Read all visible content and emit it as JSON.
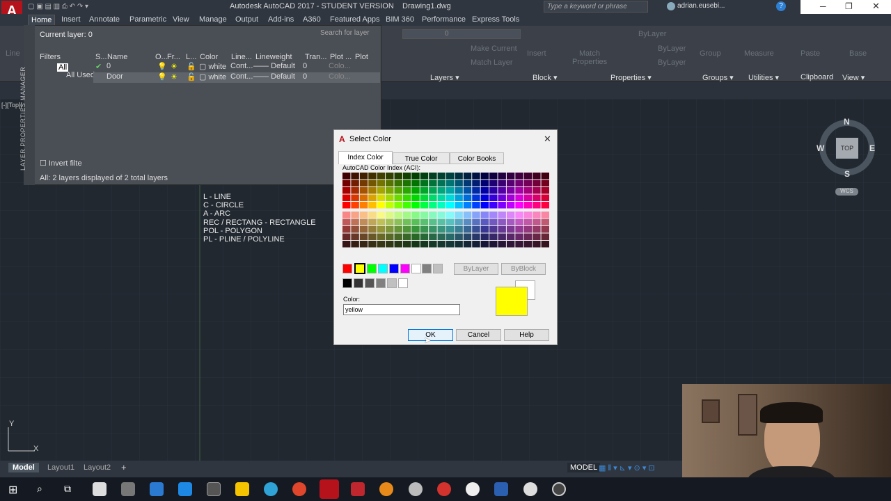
{
  "app": {
    "title": "Autodesk AutoCAD 2017 - STUDENT VERSION",
    "file": "Drawing1.dwg",
    "search_placeholder": "Type a keyword or phrase",
    "user": "adrian.eusebi...",
    "logo": "A"
  },
  "ribbon": {
    "tabs": [
      "Home",
      "Insert",
      "Annotate",
      "Parametric",
      "View",
      "Manage",
      "Output",
      "Add-ins",
      "A360",
      "Featured Apps",
      "BIM 360",
      "Performance",
      "Express Tools"
    ],
    "panels": {
      "layers": "Layers ▾",
      "block": "Block ▾",
      "properties": "Properties ▾",
      "groups": "Groups ▾",
      "utilities": "Utilities ▾",
      "clipboard": "Clipboard",
      "view": "View ▾"
    },
    "make_current": "Make Current",
    "match_layer": "Match Layer",
    "insert": "Insert",
    "match_properties": "Match Properties",
    "bylayer1": "ByLayer",
    "bylayer2": "ByLayer",
    "bylayer3": "ByLayer",
    "group": "Group",
    "measure": "Measure",
    "paste": "Paste",
    "base": "Base",
    "line": "Line",
    "layer_value": "0"
  },
  "viewport_label": "[-][Top][",
  "layer_manager": {
    "side_title": "LAYER PROPERTIES MANAGER",
    "current_layer": "Current layer: 0",
    "search": "Search for layer",
    "filters_label": "Filters",
    "all": "All",
    "all_used": "All Used ...",
    "invert_filter": "Invert filte",
    "status": "All: 2 layers displayed of 2 total layers",
    "headers": [
      "S...",
      "Name",
      "O...",
      "Fr...",
      "L...",
      "Color",
      "Line...",
      "Lineweight",
      "Tran...",
      "Plot ...",
      "Plot"
    ],
    "rows": [
      {
        "name": "0",
        "color": "white",
        "linetype": "Cont...",
        "lineweight": "Default",
        "transparency": "0",
        "plot_style": "Colo..."
      },
      {
        "name": "Door",
        "color": "white",
        "linetype": "Cont...",
        "lineweight": "Default",
        "transparency": "0",
        "plot_style": "Colo..."
      }
    ]
  },
  "canvas_notes": [
    "L - LINE",
    "C - CIRCLE",
    "A - ARC",
    "REC / RECTANG - RECTANGLE",
    "POL - POLYGON",
    "PL - PLINE / POLYLINE"
  ],
  "dialog": {
    "title": "Select Color",
    "tabs": [
      "Index Color",
      "True Color",
      "Color Books"
    ],
    "aci_label": "AutoCAD Color Index (ACI):",
    "bylayer": "ByLayer",
    "byblock": "ByBlock",
    "color_label": "Color:",
    "color_value": "yellow",
    "ok": "OK",
    "cancel": "Cancel",
    "help": "Help",
    "preview_color": "#ffff00"
  },
  "viewcube": {
    "n": "N",
    "s": "S",
    "e": "E",
    "w": "W",
    "top": "TOP",
    "wcs": "WCS"
  },
  "status": {
    "model": "MODEL",
    "tabs": [
      "Model",
      "Layout1",
      "Layout2"
    ],
    "add": "+"
  },
  "ucs": {
    "y": "Y",
    "x": "X"
  }
}
